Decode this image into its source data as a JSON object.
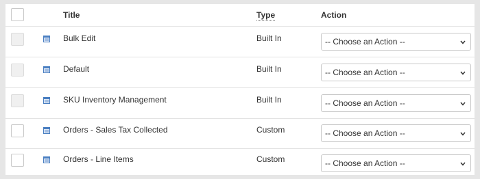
{
  "table": {
    "headers": {
      "title": "Title",
      "type": "Type",
      "action": "Action"
    },
    "rows": [
      {
        "title": "Bulk Edit",
        "type": "Built In",
        "action": "-- Choose an Action --",
        "checkbox_disabled": true
      },
      {
        "title": "Default",
        "type": "Built In",
        "action": "-- Choose an Action --",
        "checkbox_disabled": true
      },
      {
        "title": "SKU Inventory Management",
        "type": "Built In",
        "action": "-- Choose an Action --",
        "checkbox_disabled": true
      },
      {
        "title": "Orders - Sales Tax Collected",
        "type": "Custom",
        "action": "-- Choose an Action --",
        "checkbox_disabled": false
      },
      {
        "title": "Orders - Line Items",
        "type": "Custom",
        "action": "-- Choose an Action --",
        "checkbox_disabled": false
      }
    ]
  },
  "icons": {
    "row_icon": "document-icon",
    "select_icon": "chevron-down-icon"
  },
  "colors": {
    "icon_blue": "#4a7fc1",
    "background": "#e6e6e6"
  }
}
